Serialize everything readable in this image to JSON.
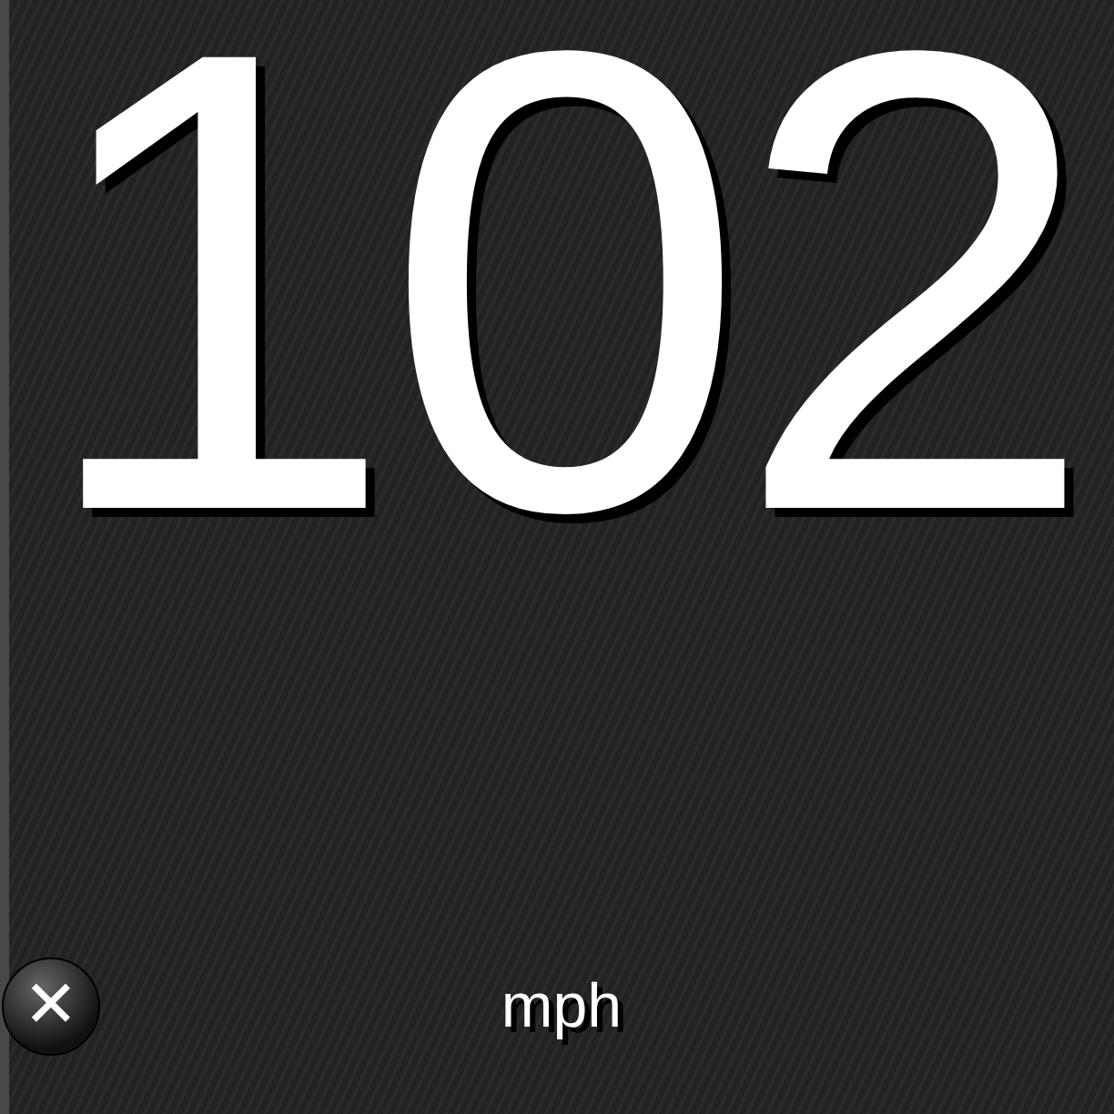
{
  "speed": {
    "value": "102",
    "unit": "mph"
  },
  "close_button": {
    "label": "✕"
  }
}
